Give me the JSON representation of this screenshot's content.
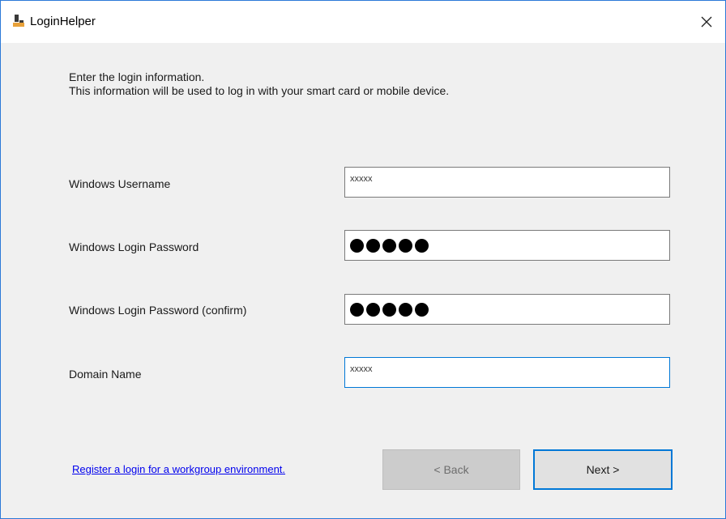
{
  "window": {
    "title": "LoginHelper",
    "close_glyph": "✕"
  },
  "instructions": {
    "line1": "Enter the login information.",
    "line2": "This information will be used to log in with your smart card or mobile device."
  },
  "fields": [
    {
      "label": "Windows Username",
      "value": "xxxxx",
      "type": "text"
    },
    {
      "label": "Windows Login Password",
      "value": "●●●●●",
      "type": "password"
    },
    {
      "label": "Windows Login Password (confirm)",
      "value": "●●●●●",
      "type": "password"
    },
    {
      "label": "Domain Name",
      "value": "xxxxx",
      "type": "text"
    }
  ],
  "footer": {
    "link_text": "Register a login for a workgroup environment.",
    "back_label": "< Back",
    "next_label": "Next >"
  },
  "colors": {
    "accent": "#0078d7",
    "link": "#0000ee",
    "window_bg": "#f0f0f0"
  }
}
